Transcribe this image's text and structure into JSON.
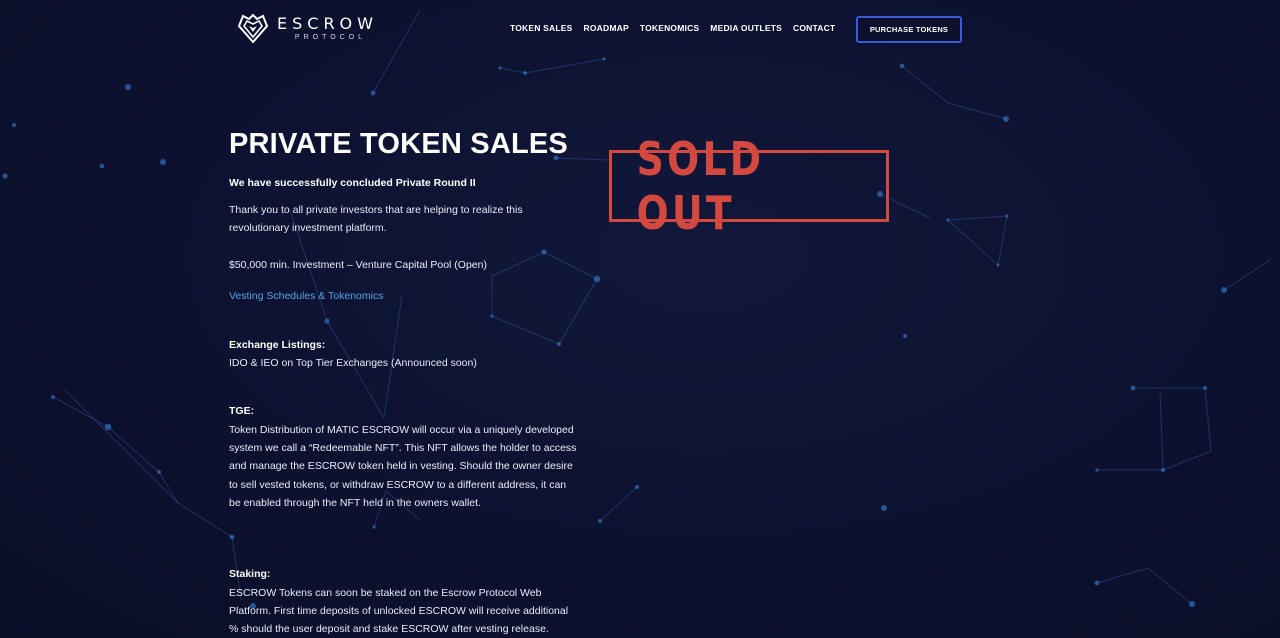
{
  "brand": {
    "name": "ESCROW",
    "sub": "PROTOCOL"
  },
  "nav": {
    "items": [
      "TOKEN SALES",
      "ROADMAP",
      "TOKENOMICS",
      "MEDIA OUTLETS",
      "CONTACT"
    ],
    "cta": "PURCHASE TOKENS"
  },
  "main": {
    "title": "PRIVATE TOKEN SALES",
    "lead": "We have successfully concluded Private Round II",
    "thanks_1": "Thank you to all private investors that are helping to realize this",
    "thanks_2": "revolutionary investment platform.",
    "investment": "$50,000 min. Investment – Venture Capital Pool (Open)",
    "vesting_link": "Vesting Schedules & Tokenomics",
    "exchange_label": "Exchange Listings:",
    "exchange_text": "IDO & IEO on Top Tier Exchanges (Announced soon)",
    "tge_label": "TGE:",
    "tge_lines": [
      "Token Distribution of MATIC ESCROW will occur via a uniquely developed",
      "system we call a “Redeemable NFT”. This NFT allows the holder to access",
      "and manage the ESCROW token held in vesting. Should the owner desire",
      "to sell vested tokens, or withdraw ESCROW to a different address, it can",
      "be enabled through the NFT held in the owners wallet."
    ],
    "staking_label": "Staking:",
    "staking_lines": [
      "ESCROW Tokens can soon be staked on the Escrow Protocol Web",
      "Platform. First time deposits of unlocked ESCROW will receive additional",
      "% should the user deposit and stake ESCROW after vesting release."
    ]
  },
  "stamp": {
    "text": "SOLD OUT"
  },
  "colors": {
    "background": "#0d1230",
    "accent": "#3a5bd8",
    "link": "#4fa3e6",
    "stamp": "#d4493f"
  }
}
